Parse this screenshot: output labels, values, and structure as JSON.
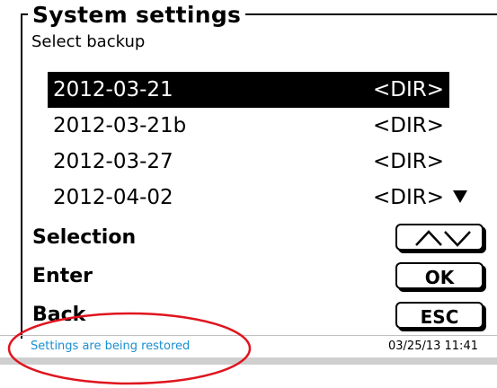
{
  "header": {
    "title": "System settings",
    "subtitle": "Select backup"
  },
  "backups": [
    {
      "name": "2012-03-21",
      "type": "<DIR>",
      "selected": true
    },
    {
      "name": "2012-03-21b",
      "type": "<DIR>",
      "selected": false
    },
    {
      "name": "2012-03-27",
      "type": "<DIR>",
      "selected": false
    },
    {
      "name": "2012-04-02",
      "type": "<DIR>",
      "selected": false
    }
  ],
  "actions": {
    "selection_label": "Selection",
    "enter_label": "Enter",
    "enter_key": "OK",
    "back_label": "Back",
    "back_key": "ESC"
  },
  "status": {
    "message": "Settings are being restored",
    "datetime": "03/25/13 11:41"
  },
  "colors": {
    "status_text": "#1a8fd0",
    "annotation": "#e0141e",
    "selected_bg": "#000000"
  },
  "icons": {
    "scroll_down": "triangle-down-icon",
    "up": "chevron-up-icon",
    "down": "chevron-down-icon"
  }
}
